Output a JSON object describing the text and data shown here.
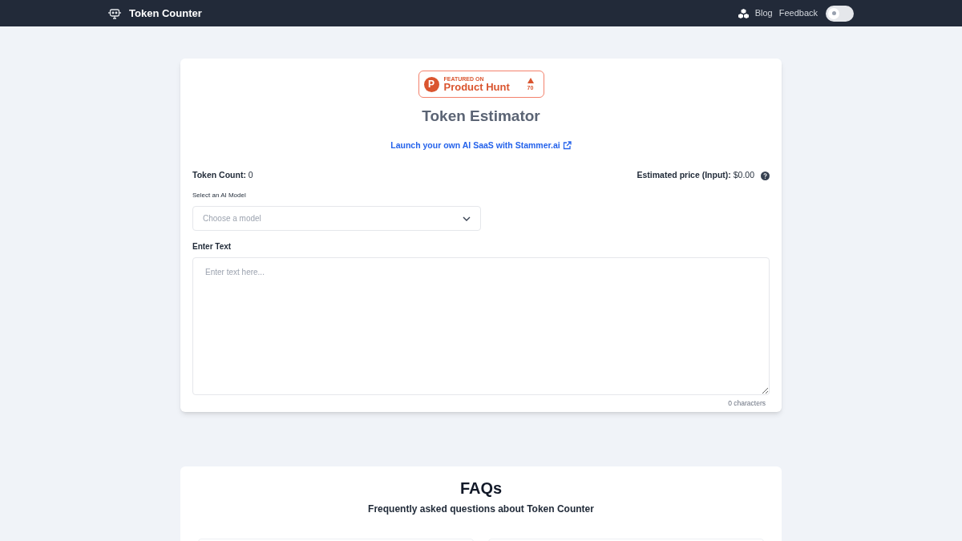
{
  "navbar": {
    "title": "Token Counter",
    "links": [
      "Blog",
      "Feedback"
    ],
    "theme_toggle": {
      "on": false
    }
  },
  "estimator": {
    "badge": {
      "logo_letter": "P",
      "caption": "FEATURED ON",
      "name": "Product Hunt",
      "upvotes": "70"
    },
    "title": "Token Estimator",
    "promo_link": "Launch your own AI SaaS with Stammer.ai",
    "token_count": {
      "label": "Token Count:",
      "value": "0"
    },
    "price": {
      "label": "Estimated price (Input):",
      "value": "$0.00"
    },
    "model_label": "Select an AI Model",
    "model_select": {
      "placeholder": "Choose a model"
    },
    "text_label": "Enter Text",
    "text_area": {
      "placeholder": "Enter text here..."
    },
    "char_count": "0 characters"
  },
  "faqs": {
    "title": "FAQs",
    "subtitle": "Frequently asked questions about Token Counter"
  }
}
